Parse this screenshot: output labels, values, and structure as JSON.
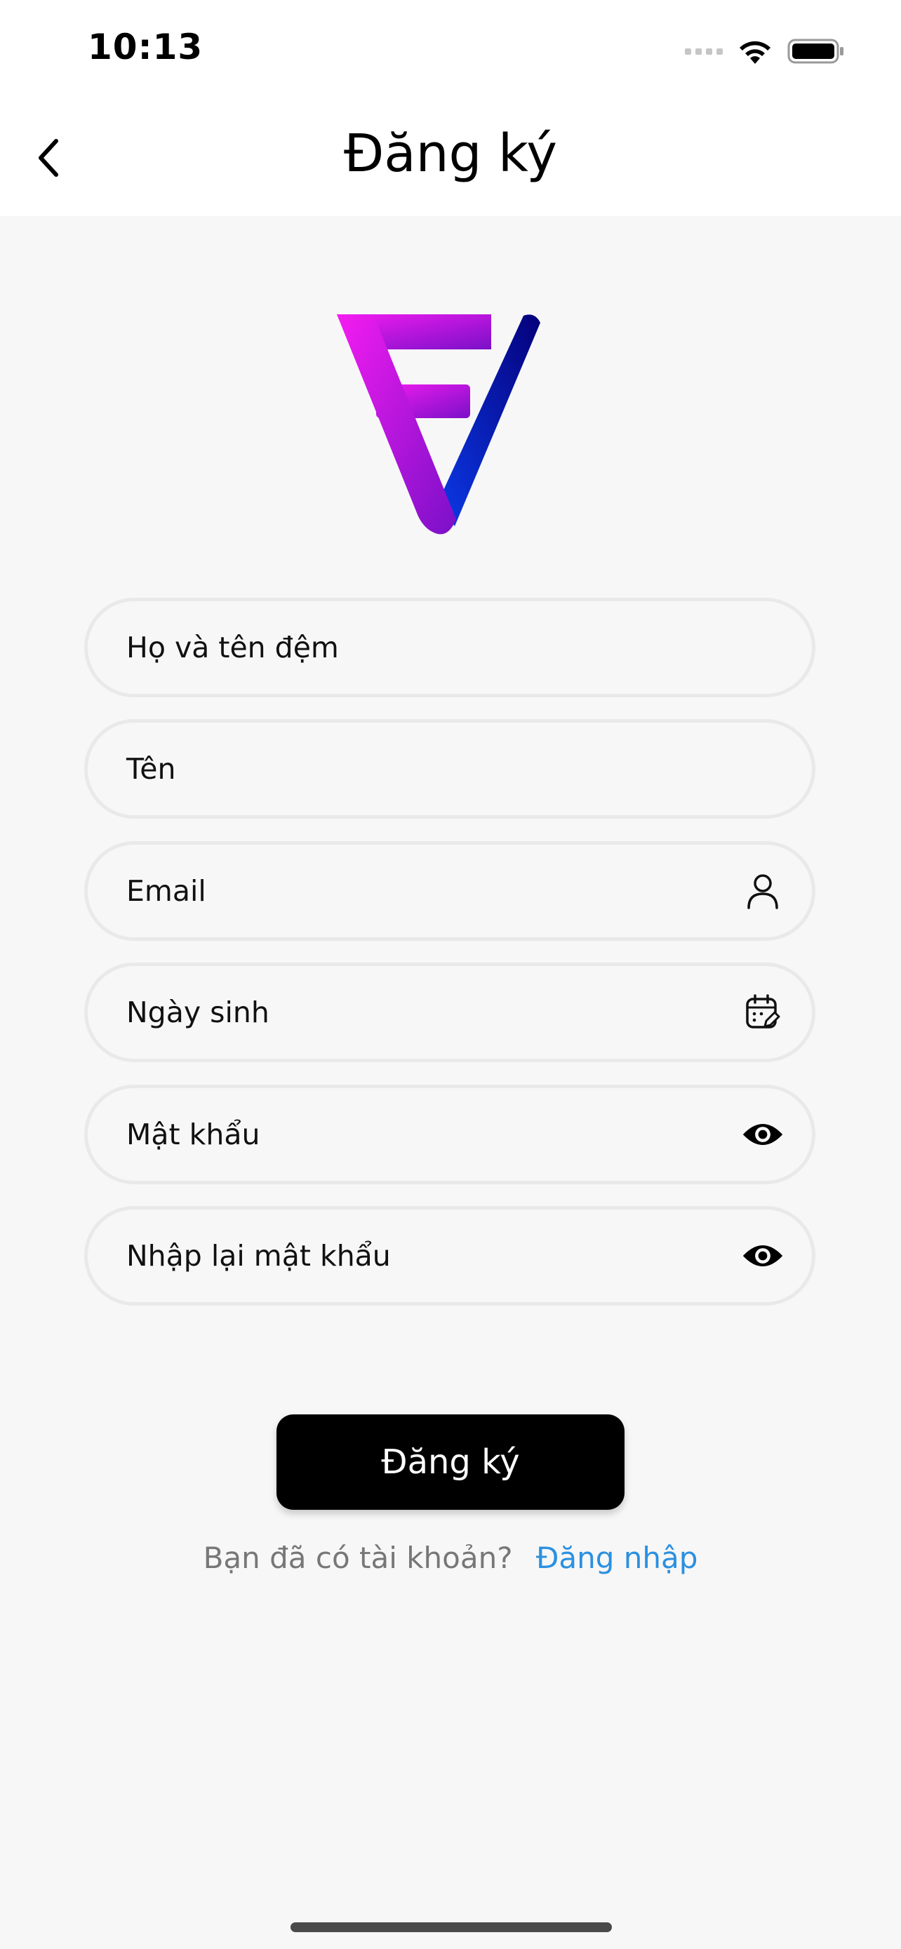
{
  "status_bar": {
    "time": "10:13"
  },
  "header": {
    "title": "Đăng ký",
    "back_icon": "chevron-left-icon"
  },
  "logo": {
    "name": "fv-logo",
    "colors": {
      "left_start": "#f41cf0",
      "left_end": "#7a10c8",
      "right_start": "#0b3ae8",
      "right_end": "#05007a"
    }
  },
  "form": {
    "fields": [
      {
        "label": "Họ và tên đệm",
        "icon": null
      },
      {
        "label": "Tên",
        "icon": null
      },
      {
        "label": "Email",
        "icon": "person-icon"
      },
      {
        "label": "Ngày sinh",
        "icon": "calendar-edit-icon"
      },
      {
        "label": "Mật khẩu",
        "icon": "eye-icon"
      },
      {
        "label": "Nhập lại mật khẩu",
        "icon": "eye-icon"
      }
    ],
    "submit_label": "Đăng ký"
  },
  "footer": {
    "question": "Bạn đã có tài khoản?",
    "login_link": "Đăng nhập"
  },
  "colors": {
    "background": "#f7f7f7",
    "header_background": "#ffffff",
    "button": "#000000",
    "link": "#2b90e0",
    "field_border": "#e9e9e9"
  }
}
